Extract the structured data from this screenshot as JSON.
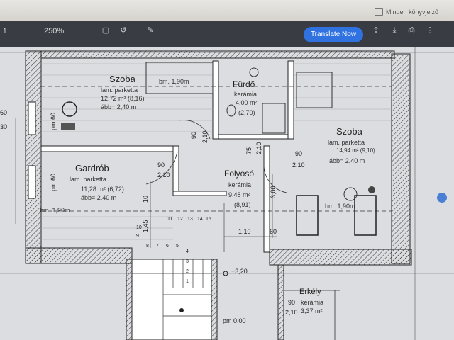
{
  "browser": {
    "bookmark_label": "Minden könyvjelző"
  },
  "toolbar": {
    "page": "1",
    "zoom": "250%",
    "translate_label": "Translate Now"
  },
  "rooms": {
    "szoba1": {
      "name": "Szoba",
      "floor": "lam. parketta",
      "area": "12,72 m² (8,16)",
      "height": "ább= 2,40 m",
      "bm": "bm. 1,90m"
    },
    "furdo": {
      "name": "Fürdő",
      "floor": "kerámia",
      "area": "4,00 m²",
      "net": "(2,70)"
    },
    "szoba2": {
      "name": "Szoba",
      "floor": "lam. parketta",
      "area": "14,94 m² (9,10)",
      "height": "ább= 2,40 m",
      "bm": "bm. 1,90m"
    },
    "gardrob": {
      "name": "Gardrób",
      "floor": "lam. parketta",
      "area": "11,28 m² (6,72)",
      "height": "ább= 2,40 m",
      "bm": "bm. 1,90m"
    },
    "folyoso": {
      "name": "Folyosó",
      "floor": "kerámia",
      "area": "9,48 m²",
      "net": "(8,91)"
    },
    "erkely": {
      "name": "Erkély",
      "floor": "kerámia",
      "area": "3,37 m²"
    }
  },
  "dims": {
    "pm60a": "pm 60",
    "pm60b": "pm 60",
    "d90a": "90",
    "d210a": "2,10",
    "d90b": "90",
    "d210b": "2,10",
    "d90c": "90",
    "d210c": "2,10",
    "d75a": "75",
    "d210d": "2,10",
    "d300": "3,00",
    "d110": "1,10",
    "d60": "60",
    "d145": "1,45",
    "d10": "10",
    "d320": "+3,20",
    "pm000": "pm 0,00",
    "d90e": "90",
    "d210e": "2,10",
    "left30": "30",
    "left60": "60"
  },
  "stairs": [
    "1",
    "2",
    "3",
    "4",
    "5",
    "6",
    "7",
    "8",
    "9",
    "10",
    "11",
    "12",
    "13",
    "14",
    "15"
  ]
}
